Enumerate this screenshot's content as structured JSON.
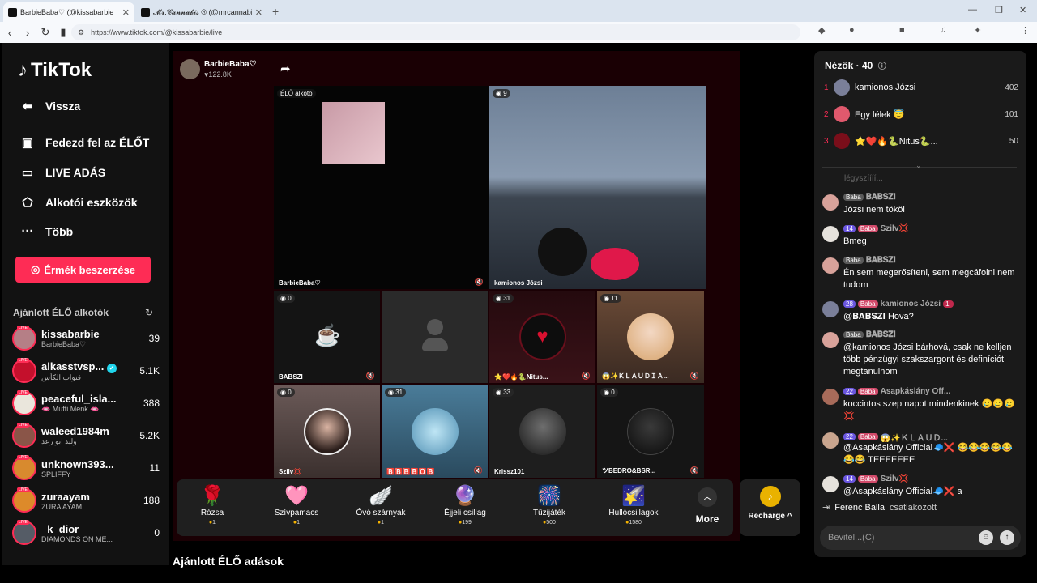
{
  "browser": {
    "tabs": [
      {
        "label": "BarbieBaba♡ (@kissabarbie",
        "active": true
      },
      {
        "label": "𝓜𝓻.𝓒𝓪𝓷𝓷𝓪𝓫𝓲𝓼 ® (@mrcannabis_)",
        "active": false
      }
    ],
    "new_tab": "+",
    "url": "https://www.tiktok.com/@kissabarbie/live"
  },
  "sidebar": {
    "logo": "TikTok",
    "items": [
      {
        "label": "Vissza",
        "icon": "back-arrow-icon"
      },
      {
        "label": "Fedezd fel az ÉLŐT",
        "icon": "live-tv-icon"
      },
      {
        "label": "LIVE ADÁS",
        "icon": "camera-icon"
      },
      {
        "label": "Alkotói eszközök",
        "icon": "creator-tools-icon"
      },
      {
        "label": "Több",
        "icon": "more-dots-icon"
      }
    ],
    "coins_button": "Érmék beszerzése",
    "recommended_title": "Ajánlott ÉLŐ alkotók",
    "live_tag": "LIVE",
    "recommended": [
      {
        "name": "kissabarbie",
        "sub": "BarbieBaba♡",
        "count": "39",
        "color": "#b57f86"
      },
      {
        "name": "alkasstvsp...",
        "sub": "قنوات الكأس",
        "count": "5.1K",
        "color": "#c4102c",
        "verified": true
      },
      {
        "name": "peaceful_isla...",
        "sub": "🫦 Mufti Menk 🫦",
        "count": "388",
        "color": "#eae6dc"
      },
      {
        "name": "waleed1984m",
        "sub": "وليد ابو رعد",
        "count": "5.2K",
        "color": "#8a5548"
      },
      {
        "name": "unknown393...",
        "sub": "SPLIFFY",
        "count": "11",
        "color": "#d88a2e"
      },
      {
        "name": "zuraayam",
        "sub": "ZURA AYAM",
        "count": "188",
        "color": "#dd8a2a"
      },
      {
        "name": "_k_dior",
        "sub": "DIAMONDS ON ME...",
        "count": "0",
        "color": "#555c66"
      }
    ]
  },
  "host": {
    "name": "BarbieBaba♡",
    "likes": "♥122.8K"
  },
  "grid": {
    "main_label": "ÉLŐ alkotó",
    "main_name": "BarbieBaba♡",
    "cells": [
      {
        "name": "kamionos Józsi",
        "viewers": "9"
      },
      {
        "name": "BABSZI",
        "viewers": "0"
      },
      {
        "name": "",
        "viewers": ""
      },
      {
        "name": "⭐❤️🔥🐍Nitus...",
        "viewers": "31"
      },
      {
        "name": "😱✨ＫＬＡＵＤＩＡ...",
        "viewers": "11"
      },
      {
        "name": "Szilv💢",
        "viewers": "0"
      },
      {
        "name": "🅱️🅱️🅱️🅱️🅾️🅱️",
        "viewers": "31"
      },
      {
        "name": "Krissz101",
        "viewers": "33"
      },
      {
        "name": "ツBEDRO&BSR...",
        "viewers": "0"
      }
    ]
  },
  "gifts": [
    {
      "name": "Rózsa",
      "price": "1",
      "icon": "🌹"
    },
    {
      "name": "Szívpamacs",
      "price": "1",
      "icon": "🩷"
    },
    {
      "name": "Óvó szárnyak",
      "price": "1",
      "icon": "🪽"
    },
    {
      "name": "Éjjeli csillag",
      "price": "199",
      "icon": "🔮"
    },
    {
      "name": "Tűzijáték",
      "price": "500",
      "icon": "🎆"
    },
    {
      "name": "Hullócsillagok",
      "price": "1580",
      "icon": "🌠"
    }
  ],
  "more_label": "More",
  "recharge_label": "Recharge ^",
  "recommended_live": "Ajánlott ÉLŐ adások",
  "viewers": {
    "title": "Nézők · 40",
    "list": [
      {
        "rank": "1",
        "name": "kamionos Józsi",
        "score": "402",
        "color": "#7a7f99"
      },
      {
        "rank": "2",
        "name": "Egy lélek 😇",
        "score": "101",
        "color": "#e0596d"
      },
      {
        "rank": "3",
        "name": "⭐❤️🔥🐍Nitus🐍...",
        "score": "50",
        "color": "#7a0e1a"
      }
    ]
  },
  "chat": {
    "faded": "légyszíííí...",
    "messages": [
      {
        "badges": [
          {
            "t": "Baba",
            "c": "gray"
          }
        ],
        "name": "𝐁𝐀𝐁𝐒𝐙𝐈",
        "text": "Józsi nem tököl",
        "avatar": "#d8a29a"
      },
      {
        "badges": [
          {
            "t": "14",
            "c": "purple"
          },
          {
            "t": "Baba",
            "c": "pink"
          }
        ],
        "name": "Szilv💢",
        "text": "Bmeg",
        "avatar": "#e6e2dc"
      },
      {
        "badges": [
          {
            "t": "Baba",
            "c": "gray"
          }
        ],
        "name": "𝐁𝐀𝐁𝐒𝐙𝐈",
        "text": "Én sem megerősíteni, sem megcáfolni nem tudom",
        "avatar": "#d8a29a"
      },
      {
        "badges": [
          {
            "t": "28",
            "c": "purple"
          },
          {
            "t": "Baba",
            "c": "pink"
          }
        ],
        "name": "kamionos Józsi",
        "extra": "1.",
        "text": "@𝐁𝐀𝐁𝐒𝐙𝐈 Hova?",
        "avatar": "#7a7f99"
      },
      {
        "badges": [
          {
            "t": "Baba",
            "c": "gray"
          }
        ],
        "name": "𝐁𝐀𝐁𝐒𝐙𝐈",
        "text": "@kamionos Józsi bárhová, csak ne kelljen több pénzügyi szakszargont és definíciót megtanulnom",
        "avatar": "#d8a29a"
      },
      {
        "badges": [
          {
            "t": "22",
            "c": "purple"
          },
          {
            "t": "Baba",
            "c": "pink"
          }
        ],
        "name": "Asapkáslány Off...",
        "text": "koccintos szep napot mindenkinek 🥲🥲🥲💢",
        "avatar": "#a86b5a"
      },
      {
        "badges": [
          {
            "t": "22",
            "c": "purple"
          },
          {
            "t": "Baba",
            "c": "pink"
          }
        ],
        "name": "😱✨ＫＬＡＵＤ...",
        "text": "@Asapkáslány Official🧢❌ 😂😂😂😂😂😂😂 TEEEEEEE",
        "avatar": "#c9a58e"
      },
      {
        "badges": [
          {
            "t": "14",
            "c": "purple"
          },
          {
            "t": "Baba",
            "c": "pink"
          }
        ],
        "name": "Szilv💢",
        "text": "@Asapkáslány Official🧢❌ a",
        "avatar": "#e6e2dc"
      }
    ],
    "joined_name": "Ferenc Balla",
    "joined_text": "csatlakozott",
    "input_placeholder": "Bevitel...(C)"
  }
}
